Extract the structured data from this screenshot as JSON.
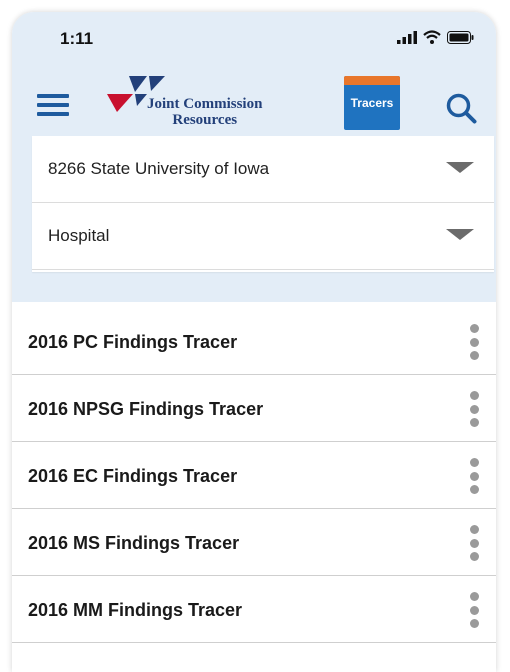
{
  "status_bar": {
    "time": "1:11",
    "signal_icon": "cellular-signal-icon",
    "wifi_icon": "wifi-icon",
    "battery_icon": "battery-icon"
  },
  "header": {
    "menu_icon": "hamburger-menu-icon",
    "logo_line1": "Joint Commission",
    "logo_line2": "Resources",
    "tracers_label": "Tracers",
    "search_icon": "search-icon"
  },
  "filters": {
    "organization": "8266 State University of Iowa",
    "program": "Hospital"
  },
  "tracer_list": [
    {
      "title": "2016 PC Findings Tracer"
    },
    {
      "title": "2016 NPSG Findings Tracer"
    },
    {
      "title": "2016 EC Findings Tracer"
    },
    {
      "title": "2016 MS Findings Tracer"
    },
    {
      "title": "2016 MM Findings Tracer"
    }
  ],
  "colors": {
    "header_background": "#e3edf7",
    "accent_blue": "#1e5b9e",
    "tracers_blue": "#1f73c0",
    "tracers_orange": "#e8762b",
    "logo_red": "#c8102e",
    "logo_navy": "#23407a"
  }
}
